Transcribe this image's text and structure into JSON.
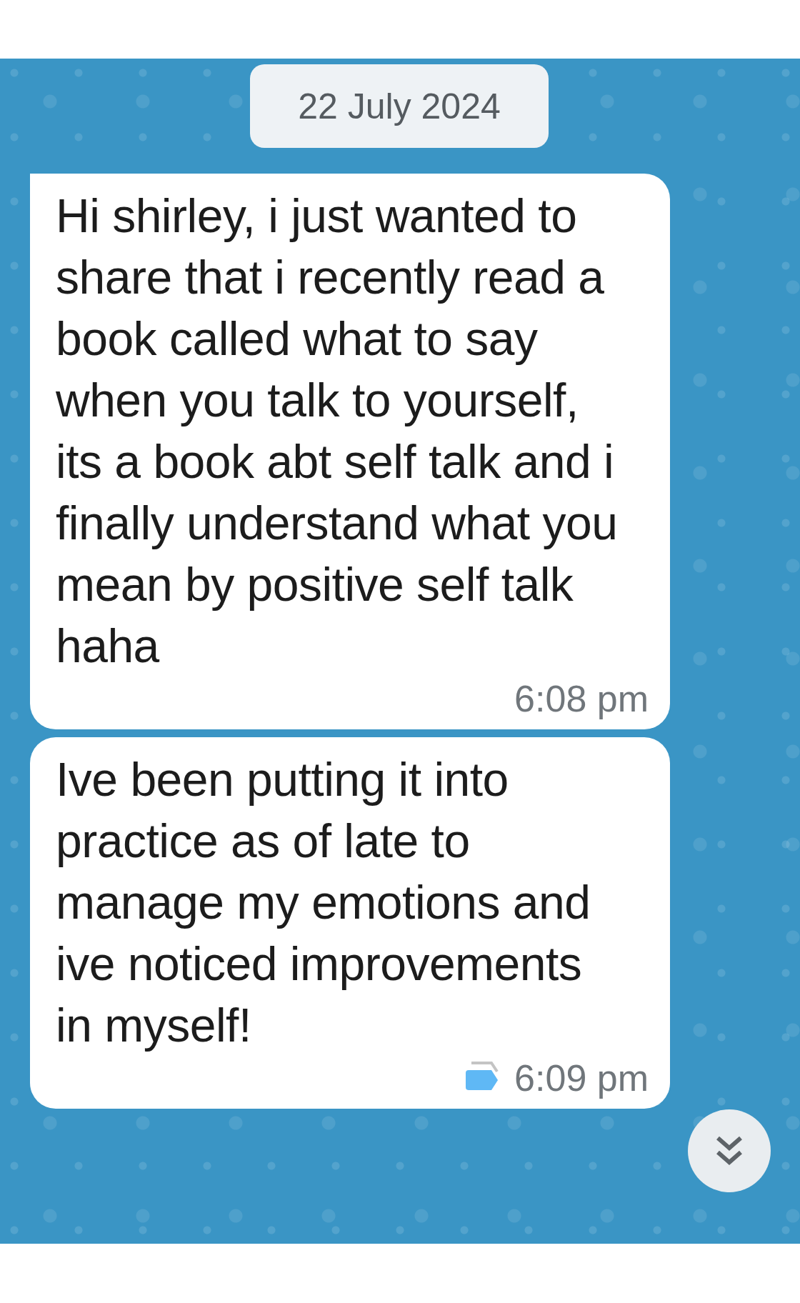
{
  "date_divider": "22 July 2024",
  "messages": [
    {
      "text": "Hi shirley, i just wanted to share that i recently read a book called what to say when you talk to yourself, its a book abt self talk and i finally understand what you mean by positive self talk haha",
      "time": "6:08 pm",
      "tail": true,
      "tagged": false
    },
    {
      "text": "Ive been putting it into practice as of late to manage my emotions and ive noticed improvements in myself!",
      "time": "6:09 pm",
      "tail": false,
      "tagged": true
    }
  ]
}
